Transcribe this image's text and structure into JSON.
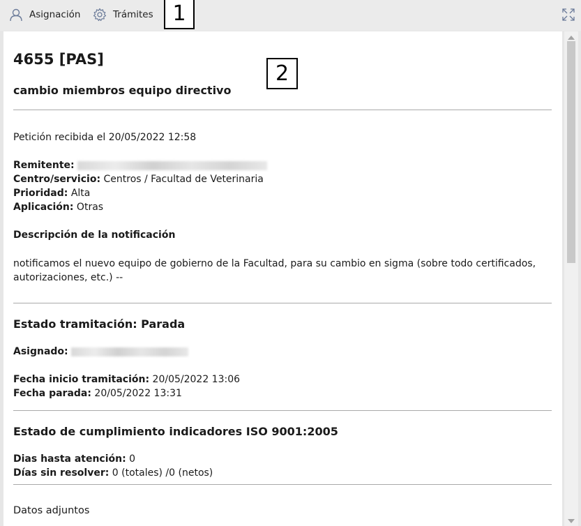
{
  "toolbar": {
    "asignacion_label": "Asignación",
    "tramites_label": "Trámites",
    "marker_1": "1",
    "marker_2": "2"
  },
  "ticket": {
    "number": "4655 [PAS]",
    "subject": "cambio miembros equipo directivo",
    "received": "Petición recibida el 20/05/2022 12:58",
    "remitente_label": "Remitente:",
    "centro_label": "Centro/servicio:",
    "centro_value": " Centros / Facultad de Veterinaria",
    "prioridad_label": "Prioridad:",
    "prioridad_value": " Alta",
    "aplicacion_label": "Aplicación:",
    "aplicacion_value": " Otras",
    "descripcion_title": "Descripción de la notificación",
    "descripcion_text": "notificamos el nuevo equipo de gobierno de la Facultad, para su cambio en sigma (sobre todo certificados, autorizaciones, etc.) --"
  },
  "estado": {
    "title": "Estado tramitación: Parada",
    "asignado_label": "Asignado:",
    "inicio_label": "Fecha inicio tramitación:",
    "inicio_value": " 20/05/2022 13:06",
    "parada_label": "Fecha parada:",
    "parada_value": " 20/05/2022 13:31"
  },
  "iso": {
    "title": "Estado de cumplimiento indicadores ISO 9001:2005",
    "dias_atencion_label": "Dias hasta atención:",
    "dias_atencion_value": " 0",
    "dias_sin_label": "Días sin resolver:",
    "dias_sin_value": " 0 (totales) /0 (netos)"
  },
  "adjuntos": {
    "title": "Datos adjuntos"
  },
  "colors": {
    "toolbar_bg": "#ebebeb",
    "panel_bg": "#ffffff",
    "icon": "#6b7b99"
  },
  "icons": [
    "user-icon",
    "gear-icon",
    "expand-icon"
  ]
}
